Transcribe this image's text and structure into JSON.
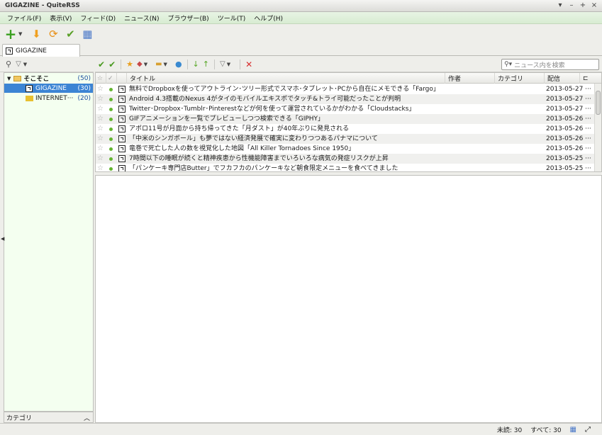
{
  "window": {
    "title": "GIGAZINE - QuiteRSS",
    "controls": [
      "▾",
      "–",
      "+",
      "×"
    ]
  },
  "menu": [
    "ファイル(F)",
    "表示(V)",
    "フィード(D)",
    "ニュース(N)",
    "ブラウザー(B)",
    "ツール(T)",
    "ヘルプ(H)"
  ],
  "tab": {
    "label": "GIGAZINE"
  },
  "feeds": [
    {
      "label": "そこそこ",
      "count": "(50)",
      "type": "folder"
    },
    {
      "label": "GIGAZINE",
      "count": "(30)",
      "type": "feed",
      "selected": true
    },
    {
      "label": "INTERNET···",
      "count": "(20)",
      "type": "feed"
    }
  ],
  "left_footer": {
    "label": "カテゴリ"
  },
  "search": {
    "placeholder": "ニュース内を検索"
  },
  "columns": {
    "title": "タイトル",
    "author": "作者",
    "category": "カテゴリ",
    "date": "配信"
  },
  "news": [
    {
      "title": "無料でDropboxを使ってアウトライン･ツリー形式でスマホ･タブレット･PCから自在にメモできる「Fargo」",
      "date": "2013-05-27 ···"
    },
    {
      "title": "Android 4.3搭載のNexus 4がタイのモバイルエキスポでタッチ&トライ可能だったことが判明",
      "date": "2013-05-27 ···"
    },
    {
      "title": "Twitter･Dropbox･Tumblr･Pinterestなどが何を使って運営されているかがわかる「Cloudstacks」",
      "date": "2013-05-27 ···"
    },
    {
      "title": "GIFアニメーションを一覧でプレビューしつつ検索できる「GIPHY」",
      "date": "2013-05-26 ···"
    },
    {
      "title": "アポロ11号が月面から持ち帰ってきた「月ダスト」が40年ぶりに発見される",
      "date": "2013-05-26 ···"
    },
    {
      "title": "「中米のシンガポール」も夢ではない経済発展で確実に変わりつつあるパナマについて",
      "date": "2013-05-26 ···"
    },
    {
      "title": "竜巻で死亡した人の数を視覚化した地図「All Killer Tornadoes Since 1950」",
      "date": "2013-05-26 ···"
    },
    {
      "title": "7時間以下の睡眠が続くと精神疾患から性機能障害までいろいろな病気の発症リスクが上昇",
      "date": "2013-05-25 ···"
    },
    {
      "title": "「パンケーキ専門店Butter」でフカフカのパンケーキなど朝食限定メニューを食べてきました",
      "date": "2013-05-25 ···"
    }
  ],
  "status": {
    "unread": "未読: 30",
    "total": "すべて: 30"
  },
  "colors": {
    "menubar": "#d8ecd2",
    "selection": "#3c84d4",
    "unread_dot": "#64b430",
    "count": "#1c4fa0"
  }
}
